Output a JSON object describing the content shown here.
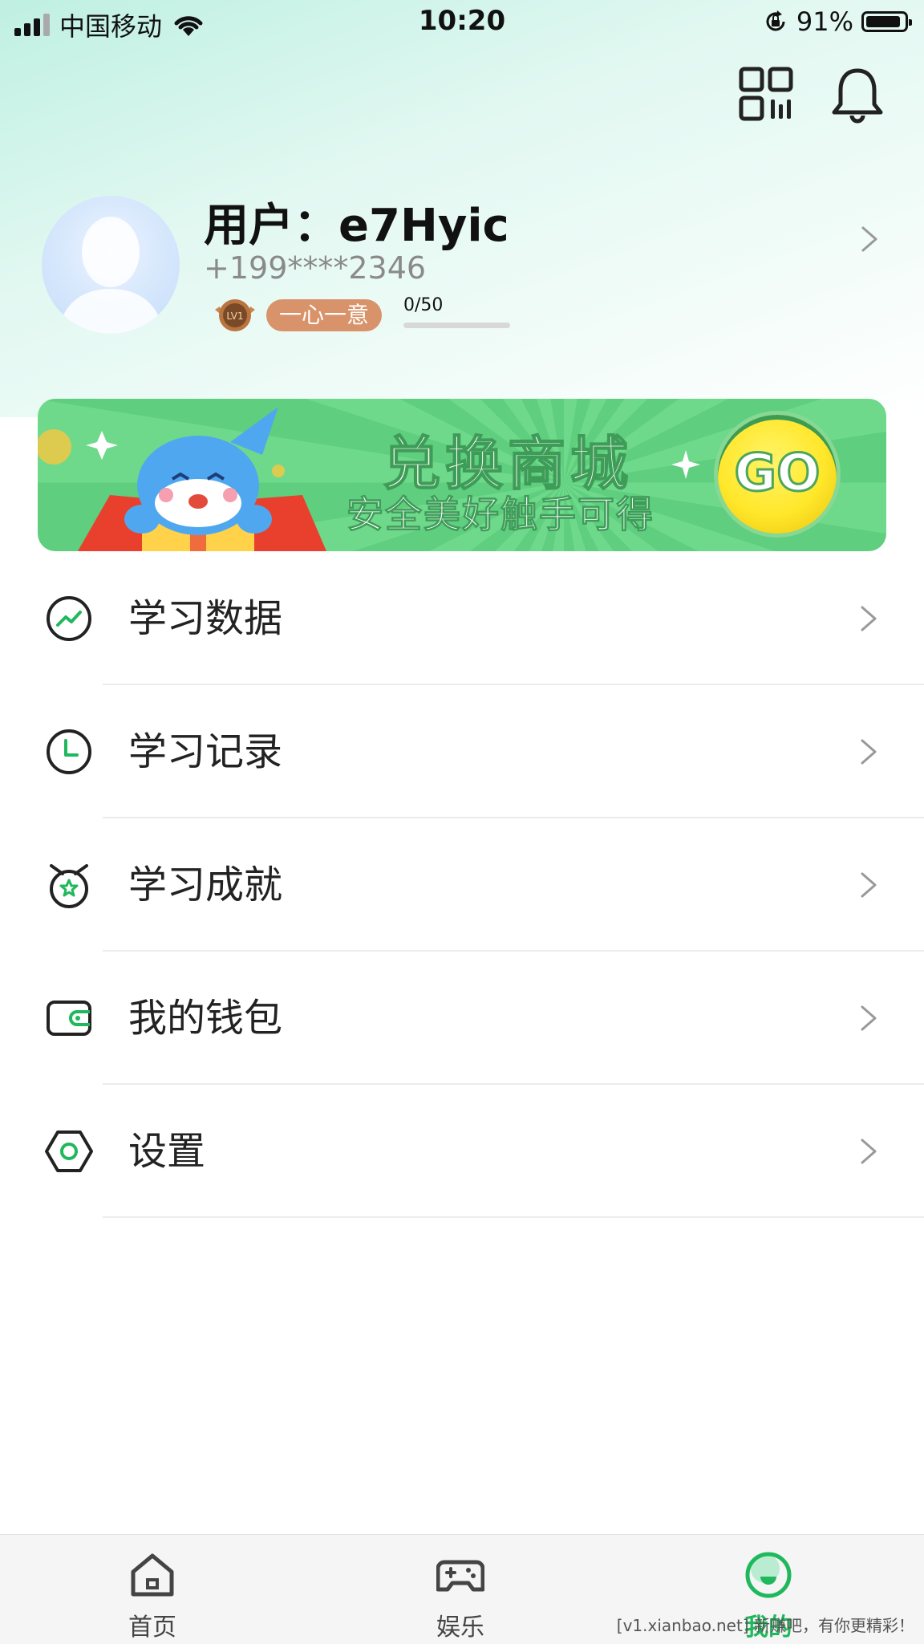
{
  "status_bar": {
    "carrier": "中国移动",
    "time": "10:20",
    "battery": "91%",
    "battery_level": 0.91
  },
  "header": {
    "icons": [
      "qr-code-icon",
      "bell-icon"
    ]
  },
  "profile": {
    "username": "用户：e7Hyic",
    "phone": "+199****2346",
    "level_badge": "LV1",
    "level_title": "一心一意",
    "progress_text": "0/50",
    "progress_value": 0
  },
  "banner": {
    "title": "兑换商城",
    "subtitle": "安全美好触手可得",
    "go_label": "GO"
  },
  "menu": {
    "items": [
      {
        "label": "学习数据",
        "icon": "trend-chart-icon"
      },
      {
        "label": "学习记录",
        "icon": "clock-icon"
      },
      {
        "label": "学习成就",
        "icon": "medal-icon"
      },
      {
        "label": "我的钱包",
        "icon": "wallet-icon"
      },
      {
        "label": "设置",
        "icon": "settings-hexagon-icon"
      }
    ]
  },
  "tab_bar": {
    "tabs": [
      {
        "label": "首页",
        "icon": "home-icon"
      },
      {
        "label": "娱乐",
        "icon": "gamepad-icon"
      },
      {
        "label": "我的",
        "icon": "profile-face-icon",
        "active": true
      }
    ],
    "active_color": "#20b85c"
  },
  "watermark": "[v1.xianbao.net] 新赚吧，有你更精彩！",
  "colors": {
    "accent": "#20b85c",
    "level_tag": "#d9936a",
    "banner_green": "#5fce7e"
  }
}
